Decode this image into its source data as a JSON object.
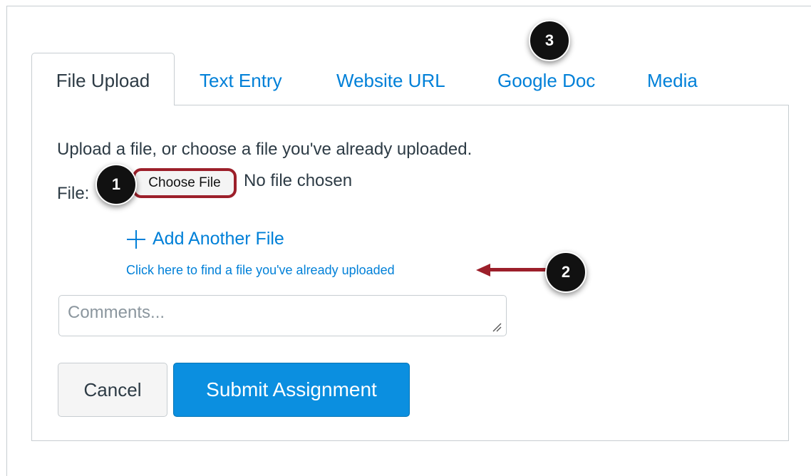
{
  "tabs": [
    {
      "label": "File Upload",
      "active": true
    },
    {
      "label": "Text Entry",
      "active": false
    },
    {
      "label": "Website URL",
      "active": false
    },
    {
      "label": "Google Doc",
      "active": false
    },
    {
      "label": "Media",
      "active": false
    }
  ],
  "upload": {
    "intro": "Upload a file, or choose a file you've already uploaded.",
    "file_label": "File:",
    "choose_file_label": "Choose File",
    "no_file_text": "No file chosen",
    "add_another_label": "Add Another File",
    "find_uploaded_link": "Click here to find a file you've already uploaded"
  },
  "comments": {
    "placeholder": "Comments...",
    "value": ""
  },
  "actions": {
    "cancel_label": "Cancel",
    "submit_label": "Submit Assignment"
  },
  "callouts": [
    "1",
    "2",
    "3"
  ],
  "colors": {
    "link": "#0080d8",
    "primary_button": "#0b8fe0",
    "highlight_border": "#9c1f2a",
    "arrow": "#9c1f2a",
    "callout_badge": "#111111"
  }
}
